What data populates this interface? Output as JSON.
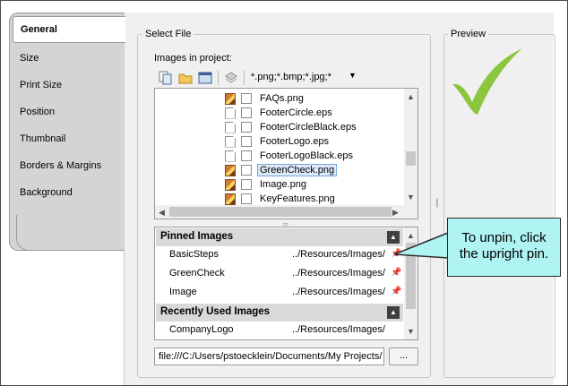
{
  "tabs": [
    {
      "label": "General",
      "active": true
    },
    {
      "label": "Size"
    },
    {
      "label": "Print Size"
    },
    {
      "label": "Position"
    },
    {
      "label": "Thumbnail"
    },
    {
      "label": "Borders & Margins"
    },
    {
      "label": "Background"
    }
  ],
  "select_file": {
    "group_label": "Select File",
    "images_label": "Images in project:",
    "filter": "*.png;*.bmp;*.jpg;*",
    "files": [
      {
        "name": "FAQs.png",
        "type": "image"
      },
      {
        "name": "FooterCircle.eps",
        "type": "doc"
      },
      {
        "name": "FooterCircleBlack.eps",
        "type": "doc"
      },
      {
        "name": "FooterLogo.eps",
        "type": "doc"
      },
      {
        "name": "FooterLogoBlack.eps",
        "type": "doc"
      },
      {
        "name": "GreenCheck.png",
        "type": "image",
        "selected": true
      },
      {
        "name": "Image.png",
        "type": "image"
      },
      {
        "name": "KeyFeatures.png",
        "type": "image"
      }
    ],
    "pinned_header": "Pinned Images",
    "pinned": [
      {
        "name": "BasicSteps",
        "path": "../Resources/Images/"
      },
      {
        "name": "GreenCheck",
        "path": "../Resources/Images/"
      },
      {
        "name": "Image",
        "path": "../Resources/Images/"
      }
    ],
    "recent_header": "Recently Used Images",
    "recent": [
      {
        "name": "CompanyLogo",
        "path": "../Resources/Images/"
      }
    ],
    "path_value": "file:///C:/Users/pstoecklein/Documents/My Projects/",
    "browse_label": "..."
  },
  "preview": {
    "group_label": "Preview",
    "check_color": "#8cc63f"
  },
  "callout": {
    "line1": "To unpin, click",
    "line2": "the upright pin."
  },
  "icons": [
    "copy-icon",
    "folder-icon",
    "window-icon",
    "disk-icon",
    "dropdown-arrow-icon",
    "pin-icon",
    "collapse-icon",
    "scroll-arrow-icon"
  ]
}
